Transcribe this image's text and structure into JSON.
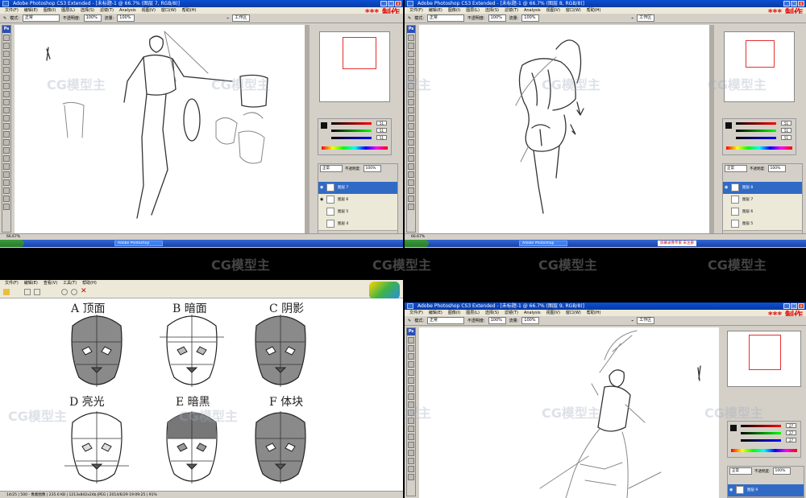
{
  "top_left": {
    "window_title": "Adobe Photoshop CS3 Extended - [未标题-1 @ 66.7% (图层 7, RGB/8)]",
    "menus": [
      "文件(F)",
      "编辑(E)",
      "图像(I)",
      "图层(L)",
      "选择(S)",
      "滤镜(T)",
      "Analysis",
      "视图(V)",
      "窗口(W)",
      "帮助(H)"
    ],
    "options": {
      "mode_label": "模式:",
      "mode_value": "正常",
      "opacity_label": "不透明度:",
      "opacity_value": "100%",
      "flow_label": "流量:",
      "flow_value": "100%",
      "workspace": "工作区"
    },
    "brand": "*** 制作",
    "color_values": [
      "51",
      "51",
      "51"
    ],
    "layers_blend": "正常",
    "layers_opacity_label": "不透明度:",
    "layers_opacity": "100%",
    "layers": [
      "图层 7",
      "图层 6",
      "图层 5",
      "图层 4"
    ],
    "status": "66.67%",
    "taskbar_items": [
      "Adobe Photoshop"
    ]
  },
  "top_right": {
    "window_title": "Adobe Photoshop CS3 Extended - [未标题-1 @ 66.7% (图层 8, RGB/8)]",
    "menus": [
      "文件(F)",
      "编辑(E)",
      "图像(I)",
      "图层(L)",
      "选择(S)",
      "滤镜(T)",
      "Analysis",
      "视图(V)",
      "窗口(W)",
      "帮助(H)"
    ],
    "options": {
      "mode_label": "模式:",
      "mode_value": "正常",
      "opacity_label": "不透明度:",
      "opacity_value": "100%",
      "flow_label": "流量:",
      "flow_value": "100%",
      "workspace": "工作区"
    },
    "brand": "*** 制作",
    "color_values": [
      "51",
      "51",
      "51"
    ],
    "layers_blend": "正常",
    "layers_opacity_label": "不透明度:",
    "layers_opacity": "100%",
    "layers": [
      "图层 8",
      "图层 7",
      "图层 6",
      "图层 5"
    ],
    "status": "66.67%",
    "taskbar_items": [
      "Adobe Photoshop"
    ],
    "taskbar_red": "屏幕录像专家 未注册"
  },
  "bottom_left": {
    "menus": [
      "文件(F)",
      "编辑(E)",
      "查看(V)",
      "工具(T)",
      "帮助(H)"
    ],
    "labels": [
      "A 顶面",
      "B 暗面",
      "C 阴影",
      "D 亮光",
      "E 暗黑",
      "F 体块"
    ],
    "status": "14/25 | 500 - 像素图像 | 235.6 KB | 1213x842x24b JPEG | 2014/6/29 19:09:25 | 91%"
  },
  "bottom_right": {
    "window_title": "Adobe Photoshop CS3 Extended - [未标题-1 @ 66.7% (图层 9, RGB/8)]",
    "menus": [
      "文件(F)",
      "编辑(E)",
      "图像(I)",
      "图层(L)",
      "选择(S)",
      "滤镜(T)",
      "Analysis",
      "视图(V)",
      "窗口(W)",
      "帮助(H)"
    ],
    "options": {
      "mode_label": "模式:",
      "mode_value": "正常",
      "opacity_label": "不透明度:",
      "opacity_value": "100%",
      "flow_label": "流量:",
      "flow_value": "100%",
      "workspace": "工作区"
    },
    "brand": "*** 制作",
    "color_values": [
      "27",
      "27",
      "27"
    ],
    "layers_blend": "正常",
    "layers_opacity_label": "不透明度:",
    "layers_opacity": "100%",
    "layers": [
      "图层 9"
    ]
  },
  "watermark": "CG模型主",
  "colors": {
    "xp_blue": "#0a4fd8",
    "brand_red": "#e01010",
    "canvas": "#ffffff",
    "ui_grey": "#d4d0c8"
  }
}
